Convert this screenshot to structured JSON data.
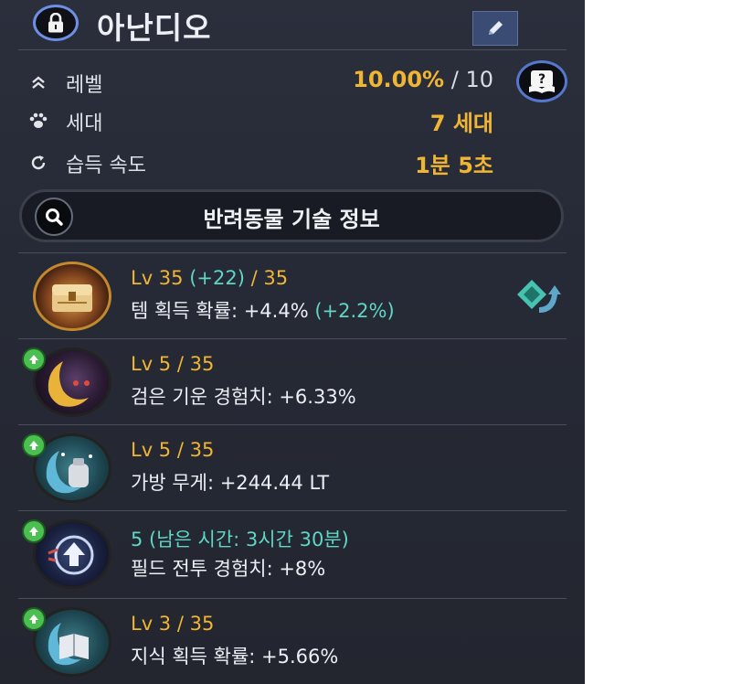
{
  "pet": {
    "name": "아난디오"
  },
  "stats": [
    {
      "label": "레벨",
      "value": "10.00%",
      "suffix": " / 10",
      "icon": "double-chevron-up-icon"
    },
    {
      "label": "세대",
      "value": "7 세대",
      "icon": "paw-icon"
    },
    {
      "label": "습득 속도",
      "value": "1분 5초",
      "icon": "refresh-icon"
    }
  ],
  "search": {
    "label": "반려동물 기술 정보"
  },
  "skills": [
    {
      "lv_main": "Lv 35 ",
      "lv_bonus": "(+22)",
      "lv_max": " / 35",
      "desc": "템 획득 확률: +4.4% ",
      "desc_bonus": "(+2.2%)",
      "icon": "treasure-chest-icon",
      "has_badge": false
    },
    {
      "lv_main": "Lv 5 / 35",
      "desc": "검은 기운 경험치: +6.33%",
      "icon": "dark-spirit-icon",
      "has_badge": true
    },
    {
      "lv_main": "Lv 5 / 35",
      "desc": "가방 무게: +244.44 LT",
      "icon": "weight-bag-icon",
      "has_badge": true
    },
    {
      "lv_main": "5 (남은 시간: 3시간 30분)",
      "desc": "필드 전투 경험치: +8%",
      "icon": "field-combat-icon",
      "has_badge": true
    },
    {
      "lv_main": "Lv 3 / 35",
      "desc": "지식 획득 확률: +5.66%",
      "icon": "knowledge-book-icon",
      "has_badge": true
    }
  ],
  "colors": {
    "accent_gold": "#f0b533",
    "accent_teal": "#5fd6c6",
    "badge_green": "#4bbf4f"
  }
}
